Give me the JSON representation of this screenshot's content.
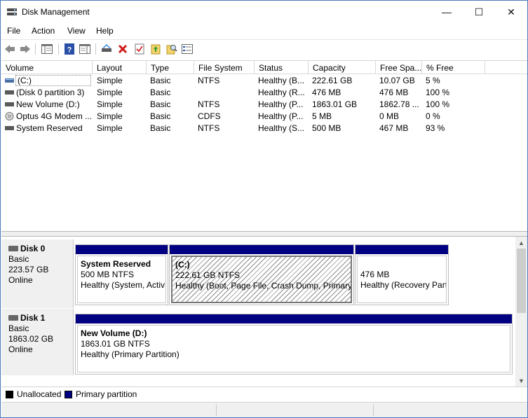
{
  "window": {
    "title": "Disk Management",
    "min_glyph": "—",
    "max_glyph": "☐",
    "close_glyph": "✕"
  },
  "menu": [
    "File",
    "Action",
    "View",
    "Help"
  ],
  "toolbar": {
    "icons": [
      "back-arrow-icon",
      "forward-arrow-icon",
      "show-hide-console-tree-icon",
      "help-icon",
      "show-action-pane-icon",
      "connect-disk-icon",
      "delete-icon",
      "properties-check-icon",
      "export-list-icon",
      "find-icon",
      "details-icon"
    ]
  },
  "columns": [
    "Volume",
    "Layout",
    "Type",
    "File System",
    "Status",
    "Capacity",
    "Free Spa...",
    "% Free"
  ],
  "volumes": [
    {
      "name": "(C:)",
      "layout": "Simple",
      "type": "Basic",
      "fs": "NTFS",
      "status": "Healthy (B...",
      "capacity": "222.61 GB",
      "free": "10.07 GB",
      "pct": "5 %"
    },
    {
      "name": "(Disk 0 partition 3)",
      "layout": "Simple",
      "type": "Basic",
      "fs": "",
      "status": "Healthy (R...",
      "capacity": "476 MB",
      "free": "476 MB",
      "pct": "100 %"
    },
    {
      "name": "New Volume (D:)",
      "layout": "Simple",
      "type": "Basic",
      "fs": "NTFS",
      "status": "Healthy (P...",
      "capacity": "1863.01 GB",
      "free": "1862.78 ...",
      "pct": "100 %"
    },
    {
      "name": "Optus 4G Modem ...",
      "layout": "Simple",
      "type": "Basic",
      "fs": "CDFS",
      "status": "Healthy (P...",
      "capacity": "5 MB",
      "free": "0 MB",
      "pct": "0 %"
    },
    {
      "name": "System Reserved",
      "layout": "Simple",
      "type": "Basic",
      "fs": "NTFS",
      "status": "Healthy (S...",
      "capacity": "500 MB",
      "free": "467 MB",
      "pct": "93 %"
    }
  ],
  "disks": [
    {
      "name": "Disk 0",
      "kind": "Basic",
      "size": "223.57 GB",
      "state": "Online",
      "partitions": [
        {
          "name": "System Reserved",
          "size": "500 MB NTFS",
          "status": "Healthy (System, Activ"
        },
        {
          "name": "(C:)",
          "size": "222.61 GB NTFS",
          "status": "Healthy (Boot, Page File, Crash Dump, Primary"
        },
        {
          "name": "",
          "size": "476 MB",
          "status": "Healthy (Recovery Part"
        }
      ]
    },
    {
      "name": "Disk 1",
      "kind": "Basic",
      "size": "1863.02 GB",
      "state": "Online",
      "partitions": [
        {
          "name": "New Volume  (D:)",
          "size": "1863.01 GB NTFS",
          "status": "Healthy (Primary Partition)"
        }
      ]
    }
  ],
  "legend": [
    {
      "label": "Unallocated",
      "color": "#000000"
    },
    {
      "label": "Primary partition",
      "color": "#000080"
    }
  ],
  "colors": {
    "primary_partition": "#000080",
    "window_border": "#4a7bbd"
  }
}
